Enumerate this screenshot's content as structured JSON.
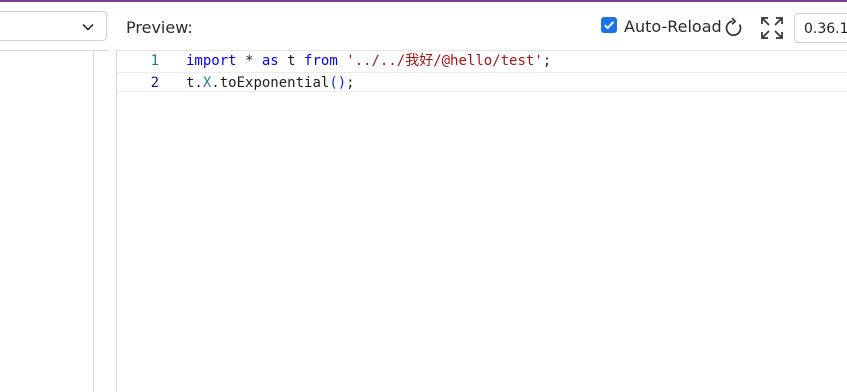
{
  "header": {
    "preview_label": "Preview:",
    "auto_reload_label": "Auto-Reload",
    "auto_reload_checked": true,
    "version": "0.36.1"
  },
  "icons": {
    "select_chevron": "chevron-down-icon",
    "checkbox": "checkmark-icon",
    "reload": "reload-icon",
    "fullscreen": "expand-icon"
  },
  "editor": {
    "lines": [
      {
        "number": "1",
        "tokens": [
          {
            "text": "import",
            "kind": "keyword"
          },
          {
            "text": " * ",
            "kind": "plain"
          },
          {
            "text": "as",
            "kind": "keyword"
          },
          {
            "text": " t ",
            "kind": "plain"
          },
          {
            "text": "from",
            "kind": "keyword"
          },
          {
            "text": " ",
            "kind": "plain"
          },
          {
            "text": "'../../我好/@hello/test'",
            "kind": "string"
          },
          {
            "text": ";",
            "kind": "plain"
          }
        ]
      },
      {
        "number": "2",
        "tokens": [
          {
            "text": "t.",
            "kind": "plain"
          },
          {
            "text": "X",
            "kind": "type"
          },
          {
            "text": ".toExponential",
            "kind": "plain"
          },
          {
            "text": "()",
            "kind": "paren"
          },
          {
            "text": ";",
            "kind": "plain"
          }
        ]
      }
    ]
  },
  "colors": {
    "accent_top_border": "#7a3d92",
    "checkbox": "#1a73e8",
    "keyword": "#0000ff",
    "string": "#a31515",
    "type": "#267f99",
    "line_number": "#237893"
  }
}
